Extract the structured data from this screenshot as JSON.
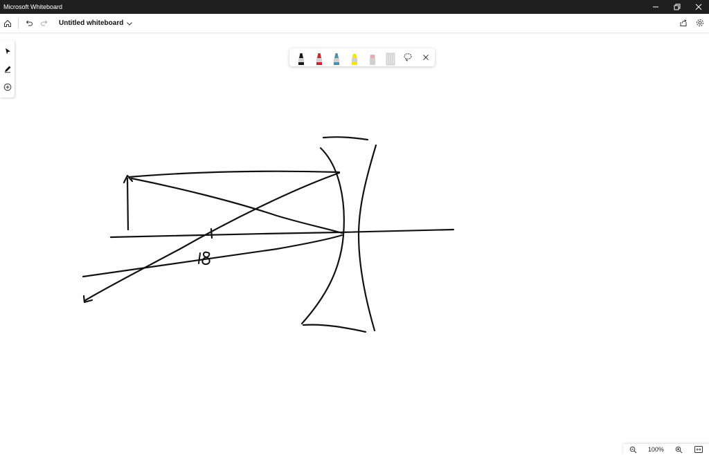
{
  "window": {
    "title": "Microsoft Whiteboard"
  },
  "appbar": {
    "board_title": "Untitled whiteboard"
  },
  "pen_tray": {
    "pens": [
      {
        "name": "black-pen",
        "color": "#1a1a1a"
      },
      {
        "name": "red-pen",
        "color": "#d8222a"
      },
      {
        "name": "blue-pen",
        "color": "#4a8fb0"
      },
      {
        "name": "yellow-highlighter",
        "color": "#f5e600"
      },
      {
        "name": "eraser",
        "color": "#e8a8ae"
      },
      {
        "name": "ruler",
        "color": "#cfcfcf"
      }
    ]
  },
  "canvas": {
    "annotation": "18"
  },
  "zoom": {
    "level": "100%"
  },
  "colors": {
    "titlebar": "#1f1f1f",
    "ink": "#111111"
  }
}
